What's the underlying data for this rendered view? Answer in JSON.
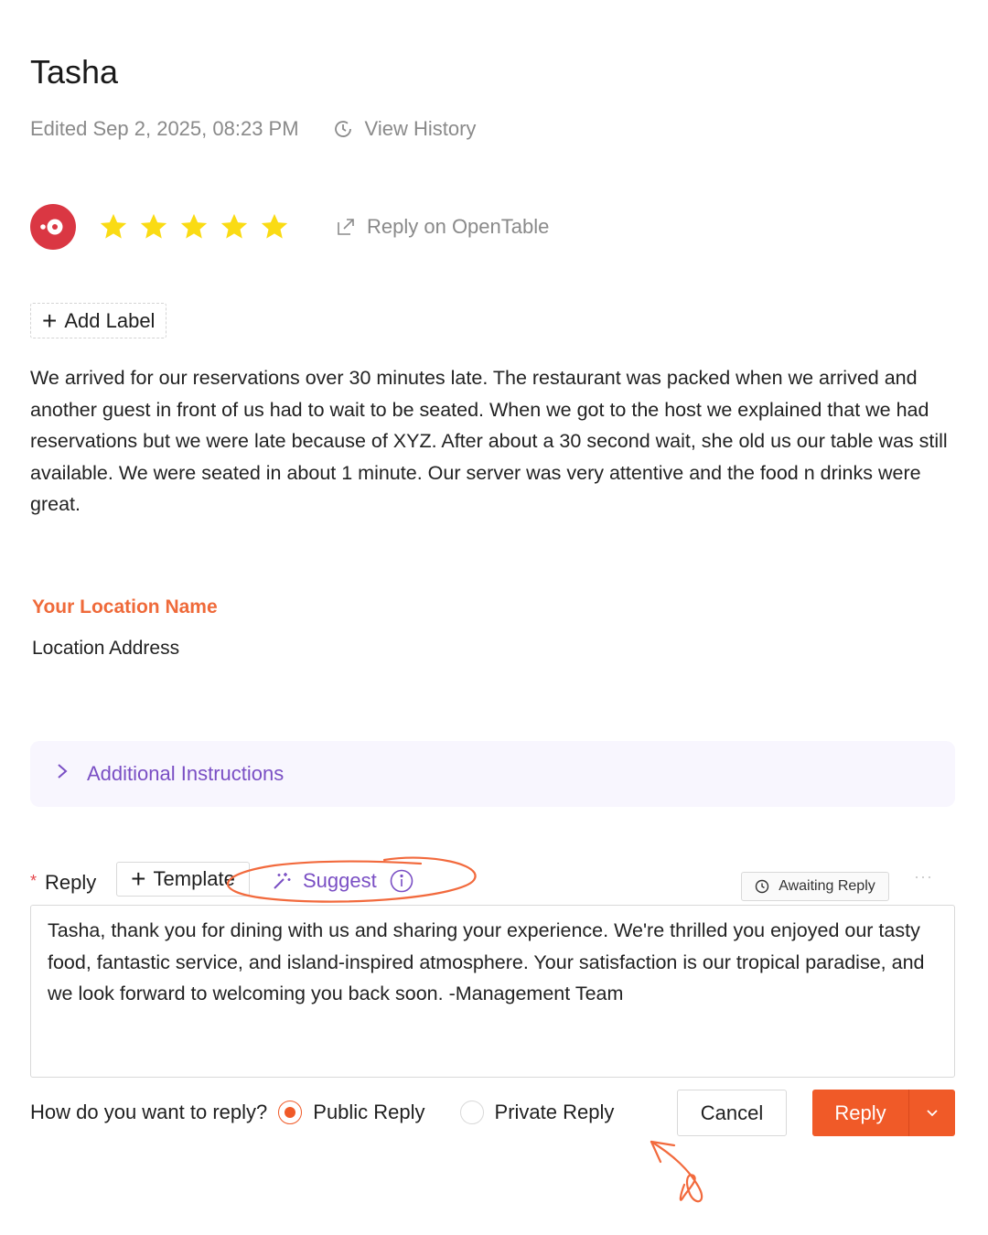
{
  "header": {
    "title": "Tasha",
    "edited": "Edited Sep 2, 2025, 08:23 PM",
    "view_history": "View History"
  },
  "rating": {
    "platform_icon": "opentable-logo",
    "stars": 5,
    "star_color": "#fadb14",
    "reply_on": "Reply on OpenTable"
  },
  "labels": {
    "add_label": "Add Label"
  },
  "review": {
    "text": "We arrived for our reservations over 30 minutes late. The restaurant was packed when we arrived and another guest in front of us had to wait to be seated. When we got to the host we explained that we had reservations but we were late because of XYZ. After about a 30 second wait, she old us our table was still available. We were seated in about 1 minute. Our server was very attentive and the food n drinks were great."
  },
  "location": {
    "name": "Your Location Name",
    "address": "Location Address",
    "name_color": "#ef6a3a"
  },
  "instructions": {
    "label": "Additional Instructions"
  },
  "reply": {
    "required_mark": "*",
    "label": "Reply",
    "template_label": "Template",
    "suggest_label": "Suggest",
    "status": "Awaiting Reply",
    "more": "···",
    "text": "Tasha, thank you for dining with us and sharing your experience. We're thrilled you enjoyed our tasty food, fantastic service, and island-inspired atmosphere. Your satisfaction is our tropical paradise, and we look forward to welcoming you back soon. -Management Team"
  },
  "reply_mode": {
    "question": "How do you want to reply?",
    "options": [
      "Public Reply",
      "Private Reply"
    ],
    "selected": "Public Reply"
  },
  "actions": {
    "cancel": "Cancel",
    "reply": "Reply"
  },
  "colors": {
    "accent": "#f05a28",
    "purple": "#7a4fc4",
    "annotation": "#f26a3d"
  }
}
